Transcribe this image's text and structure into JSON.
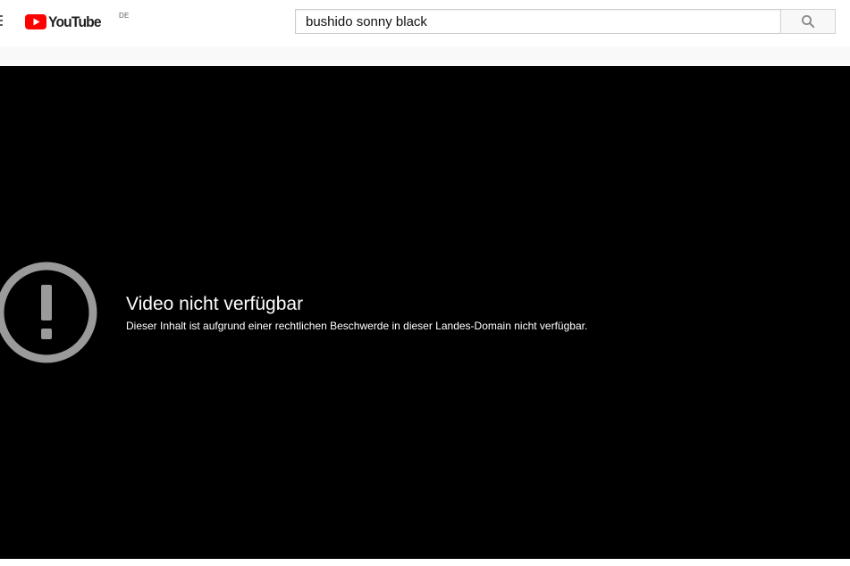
{
  "masthead": {
    "logo_text": "YouTube",
    "country_code": "DE",
    "brand_color": "#ff0000"
  },
  "search": {
    "query": "bushido sonny black",
    "icon": "search-icon"
  },
  "player": {
    "error_icon": "exclamation-circle-icon",
    "error_title": "Video nicht verfügbar",
    "error_reason": "Dieser Inhalt ist aufgrund einer rechtlichen Beschwerde in dieser Landes-Domain nicht verfügbar."
  }
}
